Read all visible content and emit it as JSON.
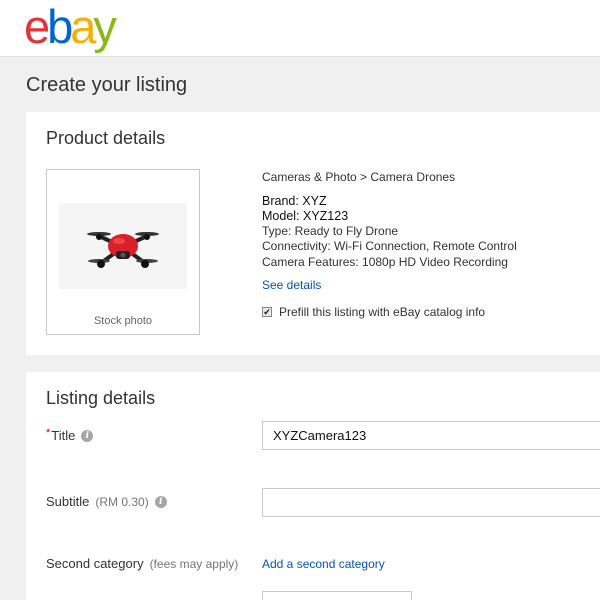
{
  "logo": {
    "letters": [
      "e",
      "b",
      "a",
      "y"
    ],
    "colors": [
      "#e53238",
      "#0064d2",
      "#f5af02",
      "#86b817"
    ]
  },
  "page": {
    "title": "Create your listing"
  },
  "product": {
    "section_title": "Product details",
    "photo_caption": "Stock photo",
    "category_path": "Cameras & Photo > Camera Drones",
    "brand": "Brand: XYZ",
    "model": "Model: XYZ123",
    "type": "Type: Ready to Fly Drone",
    "connectivity": "Connectivity: Wi-Fi Connection, Remote Control",
    "camera_features": "Camera Features: 1080p HD Video Recording",
    "see_details": "See details",
    "prefill_label": "Prefill this listing with eBay catalog info",
    "prefill_checked": true
  },
  "listing": {
    "section_title": "Listing details",
    "title_required": "*",
    "title_label": "Title",
    "title_value": "XYZCamera123",
    "subtitle_label": "Subtitle",
    "subtitle_fee": "(RM 0.30)",
    "subtitle_value": "",
    "second_category_label": "Second category",
    "second_category_note": "(fees may apply)",
    "add_second_category": "Add a second category"
  }
}
